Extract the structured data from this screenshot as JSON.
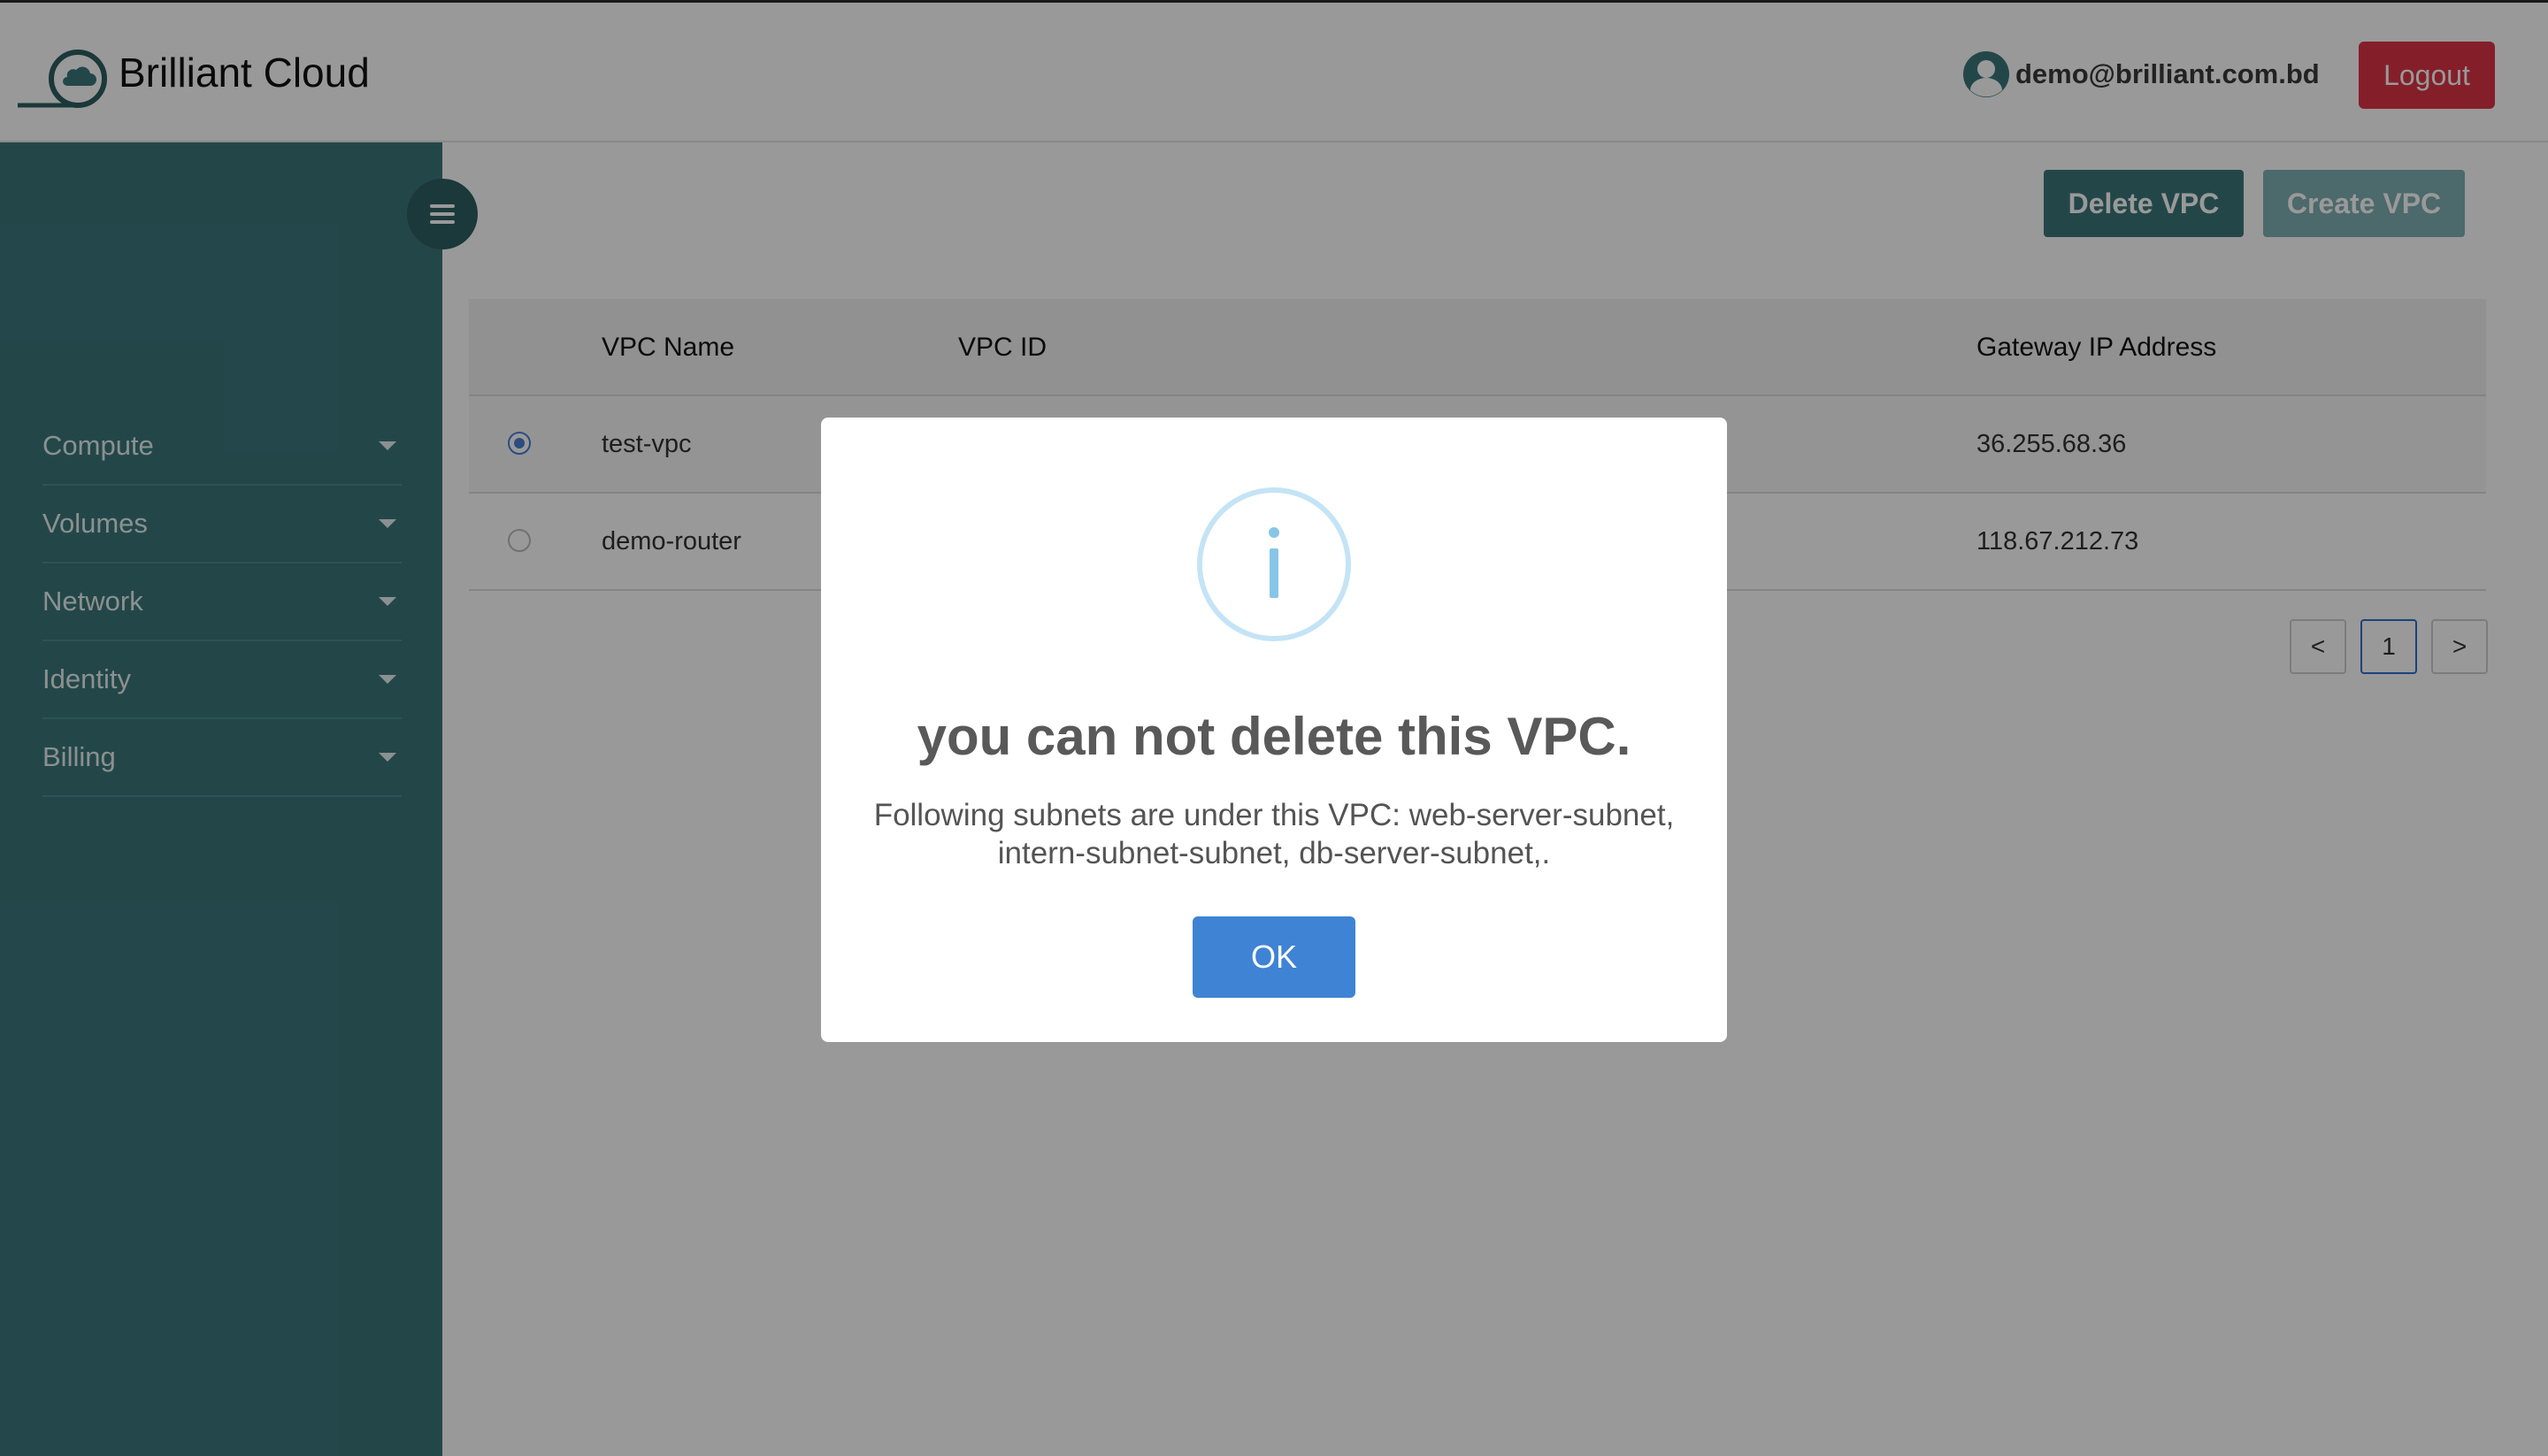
{
  "header": {
    "brand": "Brilliant Cloud",
    "user_email": "demo@brilliant.com.bd",
    "logout_label": "Logout"
  },
  "sidebar": {
    "items": [
      {
        "label": "Compute"
      },
      {
        "label": "Volumes"
      },
      {
        "label": "Network"
      },
      {
        "label": "Identity"
      },
      {
        "label": "Billing"
      }
    ]
  },
  "toolbar": {
    "delete_label": "Delete VPC",
    "create_label": "Create VPC"
  },
  "table": {
    "headers": [
      "VPC Name",
      "VPC ID",
      "Gateway IP Address"
    ],
    "rows": [
      {
        "name": "test-vpc",
        "vpc_id": "",
        "gateway_ip": "36.255.68.36",
        "selected": true
      },
      {
        "name": "demo-router",
        "vpc_id": "",
        "gateway_ip": "118.67.212.73",
        "selected": false
      }
    ]
  },
  "pagination": {
    "prev": "<",
    "current": "1",
    "next": ">"
  },
  "modal": {
    "icon": "info-icon",
    "title": "you can not delete this VPC.",
    "message_line1": "Following subnets are under this VPC: web-server-subnet,",
    "message_line2": "intern-subnet-subnet, db-server-subnet,.",
    "ok_label": "OK"
  },
  "colors": {
    "sidebar": "#3b777b",
    "primary_button": "#3b777b",
    "logout_button": "#dc3545",
    "ok_button": "#3f83d5",
    "info_icon": "#87c5e8"
  }
}
